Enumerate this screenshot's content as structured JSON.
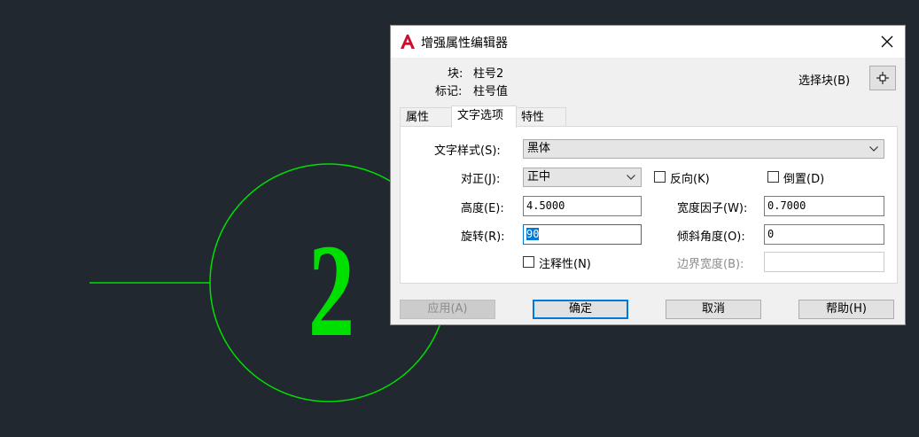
{
  "drawing": {
    "number_text": "2",
    "stroke_color": "#00e000"
  },
  "dialog": {
    "title": "增强属性编辑器",
    "block_label": "块:",
    "block_value": "柱号2",
    "tag_label": "标记:",
    "tag_value": "柱号值",
    "select_block_label": "选择块(B)",
    "tabs": [
      {
        "label": "属性"
      },
      {
        "label": "文字选项"
      },
      {
        "label": "特性"
      }
    ],
    "text_style_label": "文字样式(S):",
    "text_style_value": "黑体",
    "justify_label": "对正(J):",
    "justify_value": "正中",
    "backwards_label": "反向(K)",
    "upside_down_label": "倒置(D)",
    "height_label": "高度(E):",
    "height_value": "4.5000",
    "width_factor_label": "宽度因子(W):",
    "width_factor_value": "0.7000",
    "rotation_label": "旋转(R):",
    "rotation_value": "90",
    "oblique_label": "倾斜角度(O):",
    "oblique_value": "0",
    "annotative_label": "注释性(N)",
    "boundary_width_label": "边界宽度(B):",
    "boundary_width_value": "",
    "buttons": {
      "apply": "应用(A)",
      "ok": "确定",
      "cancel": "取消",
      "help": "帮助(H)"
    }
  },
  "colors": {
    "background": "#212830",
    "accent": "#0078d7",
    "autocad_red": "#c8102e"
  }
}
